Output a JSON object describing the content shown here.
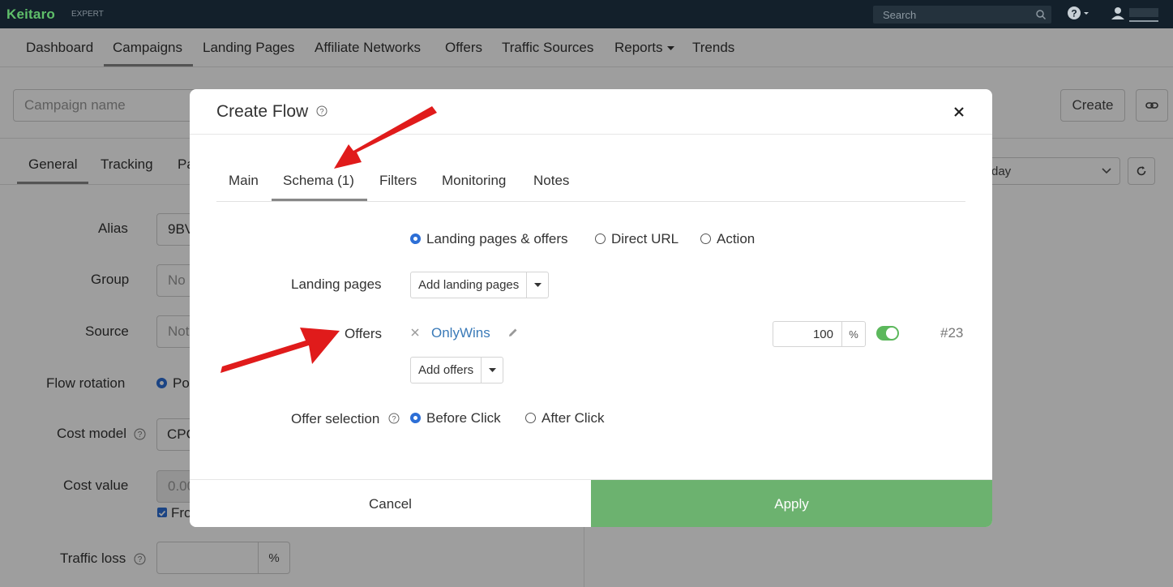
{
  "app": {
    "logo": "Keitaro",
    "edition": "EXPERT"
  },
  "search": {
    "placeholder": "Search"
  },
  "nav": {
    "items": [
      "Dashboard",
      "Campaigns",
      "Landing Pages",
      "Affiliate Networks",
      "Offers",
      "Traffic Sources",
      "Reports",
      "Trends"
    ],
    "active": "Campaigns"
  },
  "toolbar": {
    "campaign_name_placeholder": "Campaign name",
    "create_label": "Create"
  },
  "page_tabs": [
    "General",
    "Tracking",
    "Pa"
  ],
  "date_select_partial": "day",
  "form": {
    "alias_label": "Alias",
    "alias_value": "9BV",
    "group_label": "Group",
    "group_value": "No g",
    "source_label": "Source",
    "source_value": "Not",
    "flow_rotation_label": "Flow rotation",
    "flow_rotation_value": "Po",
    "cost_model_label": "Cost model",
    "cost_model_value": "CPC",
    "cost_value_label": "Cost value",
    "cost_value_value": "0.00",
    "checkbox_partial": "Fro",
    "traffic_loss_label": "Traffic loss",
    "traffic_loss_unit": "%"
  },
  "modal": {
    "title": "Create Flow",
    "tabs": [
      "Main",
      "Schema (1)",
      "Filters",
      "Monitoring",
      "Notes"
    ],
    "active_tab": "Schema (1)",
    "schema_options": [
      "Landing pages & offers",
      "Direct URL",
      "Action"
    ],
    "schema_selected": "Landing pages & offers",
    "landing_pages_label": "Landing pages",
    "add_landing_pages": "Add landing pages",
    "offers_label": "Offers",
    "offer": {
      "name": "OnlyWins",
      "weight": "100",
      "weight_unit": "%",
      "enabled": true,
      "id": "#23"
    },
    "add_offers": "Add offers",
    "offer_selection_label": "Offer selection",
    "offer_selection_options": [
      "Before Click",
      "After Click"
    ],
    "offer_selection_selected": "Before Click",
    "cancel": "Cancel",
    "apply": "Apply"
  },
  "colors": {
    "topbar": "#13202b",
    "brand_green": "#5fbf6a",
    "apply_green": "#6cb26f",
    "link_blue": "#3a7ab8",
    "radio_blue": "#2d6fd6",
    "annotation_red": "#e01b1b"
  },
  "icons": [
    "search-icon",
    "help-icon",
    "user-icon",
    "link-icon",
    "refresh-icon",
    "question-icon",
    "close-icon",
    "remove-icon",
    "pencil-icon",
    "caret-down-icon",
    "chevron-down-icon"
  ]
}
